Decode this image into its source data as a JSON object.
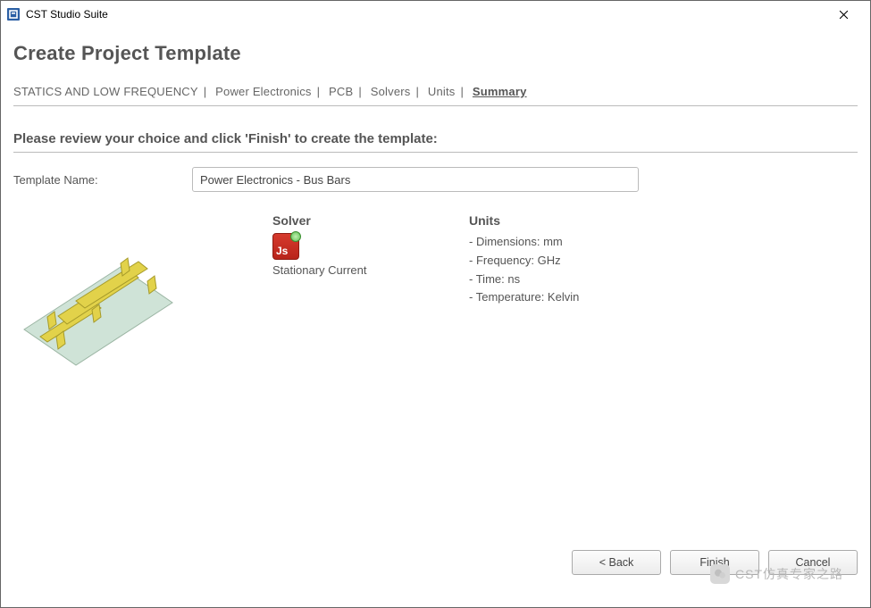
{
  "window": {
    "title": "CST Studio Suite"
  },
  "page": {
    "heading": "Create Project Template",
    "instruction": "Please review your choice and click 'Finish' to create the template:"
  },
  "breadcrumb": {
    "items": [
      {
        "label": "STATICS AND LOW FREQUENCY",
        "active": false
      },
      {
        "label": "Power Electronics",
        "active": false
      },
      {
        "label": "PCB",
        "active": false
      },
      {
        "label": "Solvers",
        "active": false
      },
      {
        "label": "Units",
        "active": false
      },
      {
        "label": "Summary",
        "active": true
      }
    ]
  },
  "form": {
    "template_name_label": "Template Name:",
    "template_name_value": "Power Electronics - Bus Bars"
  },
  "summary": {
    "solver": {
      "title": "Solver",
      "icon_text": "Js",
      "name": "Stationary Current"
    },
    "units": {
      "title": "Units",
      "rows": [
        "Dimensions: mm",
        "Frequency: GHz",
        "Time: ns",
        "Temperature: Kelvin"
      ]
    }
  },
  "buttons": {
    "back": "< Back",
    "finish": "Finish",
    "cancel": "Cancel"
  },
  "watermark": "CST仿真专家之路"
}
